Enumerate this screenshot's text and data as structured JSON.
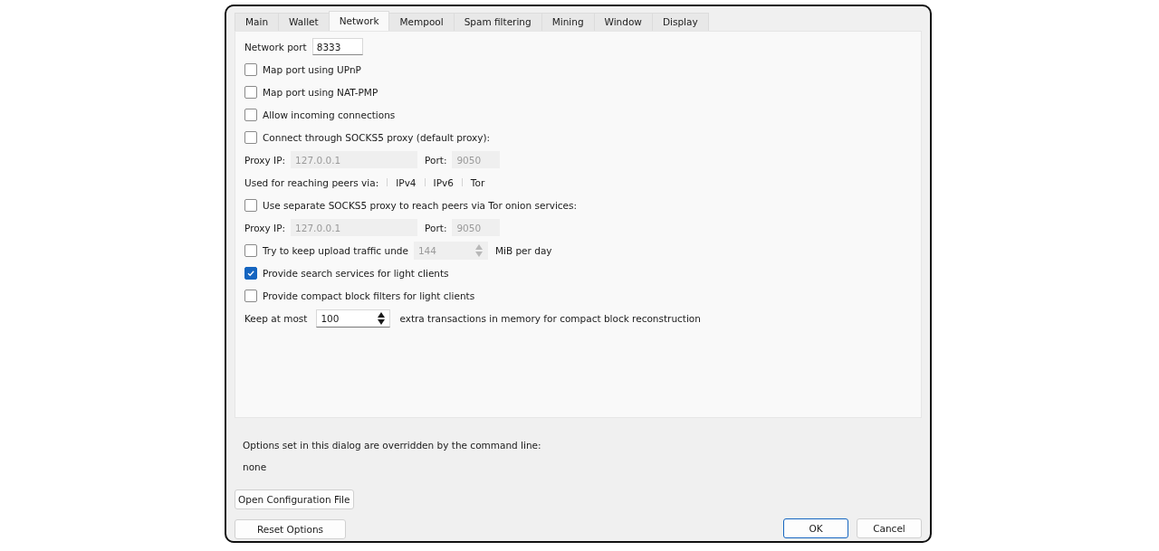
{
  "tabs": [
    {
      "label": "Main",
      "selected": false
    },
    {
      "label": "Wallet",
      "selected": false
    },
    {
      "label": "Network",
      "selected": true
    },
    {
      "label": "Mempool",
      "selected": false
    },
    {
      "label": "Spam filtering",
      "selected": false
    },
    {
      "label": "Mining",
      "selected": false
    },
    {
      "label": "Window",
      "selected": false
    },
    {
      "label": "Display",
      "selected": false
    }
  ],
  "rows": [
    {
      "kind": "field",
      "label": "Network port",
      "value": "8333"
    },
    {
      "kind": "checkbox",
      "label": "Map port using UPnP",
      "checked": false
    },
    {
      "kind": "checkbox",
      "label": "Map port using NAT-PMP",
      "checked": false
    },
    {
      "kind": "checkbox",
      "label": "Allow incoming connections",
      "checked": false
    },
    {
      "kind": "checkbox",
      "label": "Connect through SOCKS5 proxy (default proxy):",
      "checked": false
    },
    {
      "kind": "proxy",
      "ip_label": "Proxy IP:",
      "ip": "127.0.0.1",
      "port_label": "Port:",
      "port": "9050",
      "disabled": true
    },
    {
      "kind": "networks",
      "label": "Used for reaching peers via:",
      "items": [
        "IPv4",
        "IPv6",
        "Tor"
      ]
    },
    {
      "kind": "checkbox",
      "label": "Use separate SOCKS5 proxy to reach peers via Tor onion services:",
      "checked": false
    },
    {
      "kind": "proxy",
      "ip_label": "Proxy IP:",
      "ip": "127.0.0.1",
      "port_label": "Port:",
      "port": "9050",
      "disabled": true
    },
    {
      "kind": "limit",
      "label": "Try to keep upload traffic unde",
      "checked": false,
      "value": "144",
      "unit": "MiB per day",
      "disabled": true
    },
    {
      "kind": "checkbox",
      "label": "Provide search services for light clients",
      "checked": true
    },
    {
      "kind": "checkbox",
      "label": "Provide compact block filters for light clients",
      "checked": false
    },
    {
      "kind": "spin",
      "label": "Keep at most",
      "value": "100",
      "suffix": "extra transactions in memory for compact block reconstruction"
    }
  ],
  "override_note": "Options set in this dialog are overridden by the command line:",
  "override_value": "none",
  "buttons": [
    {
      "label": "Open Configuration File",
      "kind": "left"
    },
    {
      "label": "Reset Options",
      "kind": "left"
    },
    {
      "label": "OK",
      "kind": "default"
    },
    {
      "label": "Cancel",
      "kind": "right"
    }
  ]
}
